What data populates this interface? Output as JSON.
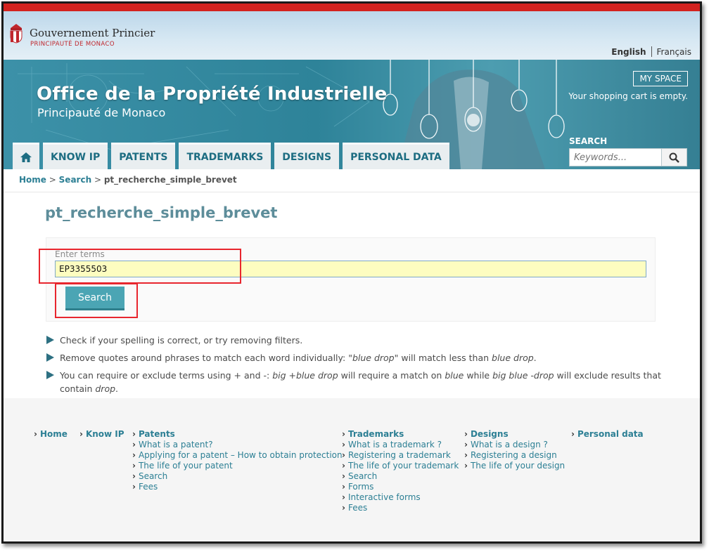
{
  "header": {
    "gov_title": "Gouvernement Princier",
    "gov_subtitle": "PRINCIPAUTÉ DE MONACO",
    "lang_en": "English",
    "lang_fr": "Français"
  },
  "banner": {
    "title": "Office de la Propriété Industrielle",
    "subtitle": "Principauté de Monaco",
    "my_space": "MY SPACE",
    "cart": "Your shopping cart is empty.",
    "search_label": "SEARCH",
    "search_placeholder": "Keywords..."
  },
  "nav": {
    "tabs": [
      {
        "label": "KNOW IP"
      },
      {
        "label": "PATENTS"
      },
      {
        "label": "TRADEMARKS"
      },
      {
        "label": "DESIGNS"
      },
      {
        "label": "PERSONAL DATA"
      }
    ]
  },
  "breadcrumb": {
    "home": "Home",
    "sep": ">",
    "search": "Search",
    "current": "pt_recherche_simple_brevet"
  },
  "main": {
    "title": "pt_recherche_simple_brevet",
    "terms_label": "Enter terms",
    "terms_value": "EP3355503",
    "search_button": "Search",
    "tips": [
      {
        "text": "Check if your spelling is correct, or try removing filters."
      },
      {
        "pre": "Remove quotes around phrases to match each word individually: ",
        "em1": "\"blue drop\"",
        "mid": " will match less than ",
        "em2": "blue drop",
        "post": "."
      },
      {
        "pre": "You can require or exclude terms using + and -: ",
        "em1": "big +blue drop",
        "mid1": " will require a match on ",
        "em2": "blue",
        "mid2": " while ",
        "em3": "big blue -drop",
        "mid3": " will exclude results that contain ",
        "em4": "drop",
        "post": "."
      }
    ]
  },
  "footer": {
    "home": "Home",
    "know_ip": "Know IP",
    "patents": {
      "title": "Patents",
      "links": [
        "What is a patent?",
        "Applying for a patent – How to obtain protection",
        "The life of your patent",
        "Search",
        "Fees"
      ]
    },
    "trademarks": {
      "title": "Trademarks",
      "links": [
        "What is a trademark ?",
        "Registering a trademark",
        "The life of your trademark",
        "Search",
        "Forms",
        "Interactive forms",
        "Fees"
      ]
    },
    "designs": {
      "title": "Designs",
      "links": [
        "What is a design ?",
        "Registering a design",
        "The life of your design"
      ]
    },
    "personal_data": "Personal data"
  },
  "icons": {
    "home": "home-icon",
    "search": "magnifier-icon",
    "crest": "monaco-crest-icon"
  },
  "colors": {
    "top_bar": "#d3231f",
    "banner": "#2e8399",
    "accent": "#2c7f94",
    "button": "#4ba5b4",
    "input_highlight": "#fdfdc0",
    "annotation": "#e8262e"
  }
}
